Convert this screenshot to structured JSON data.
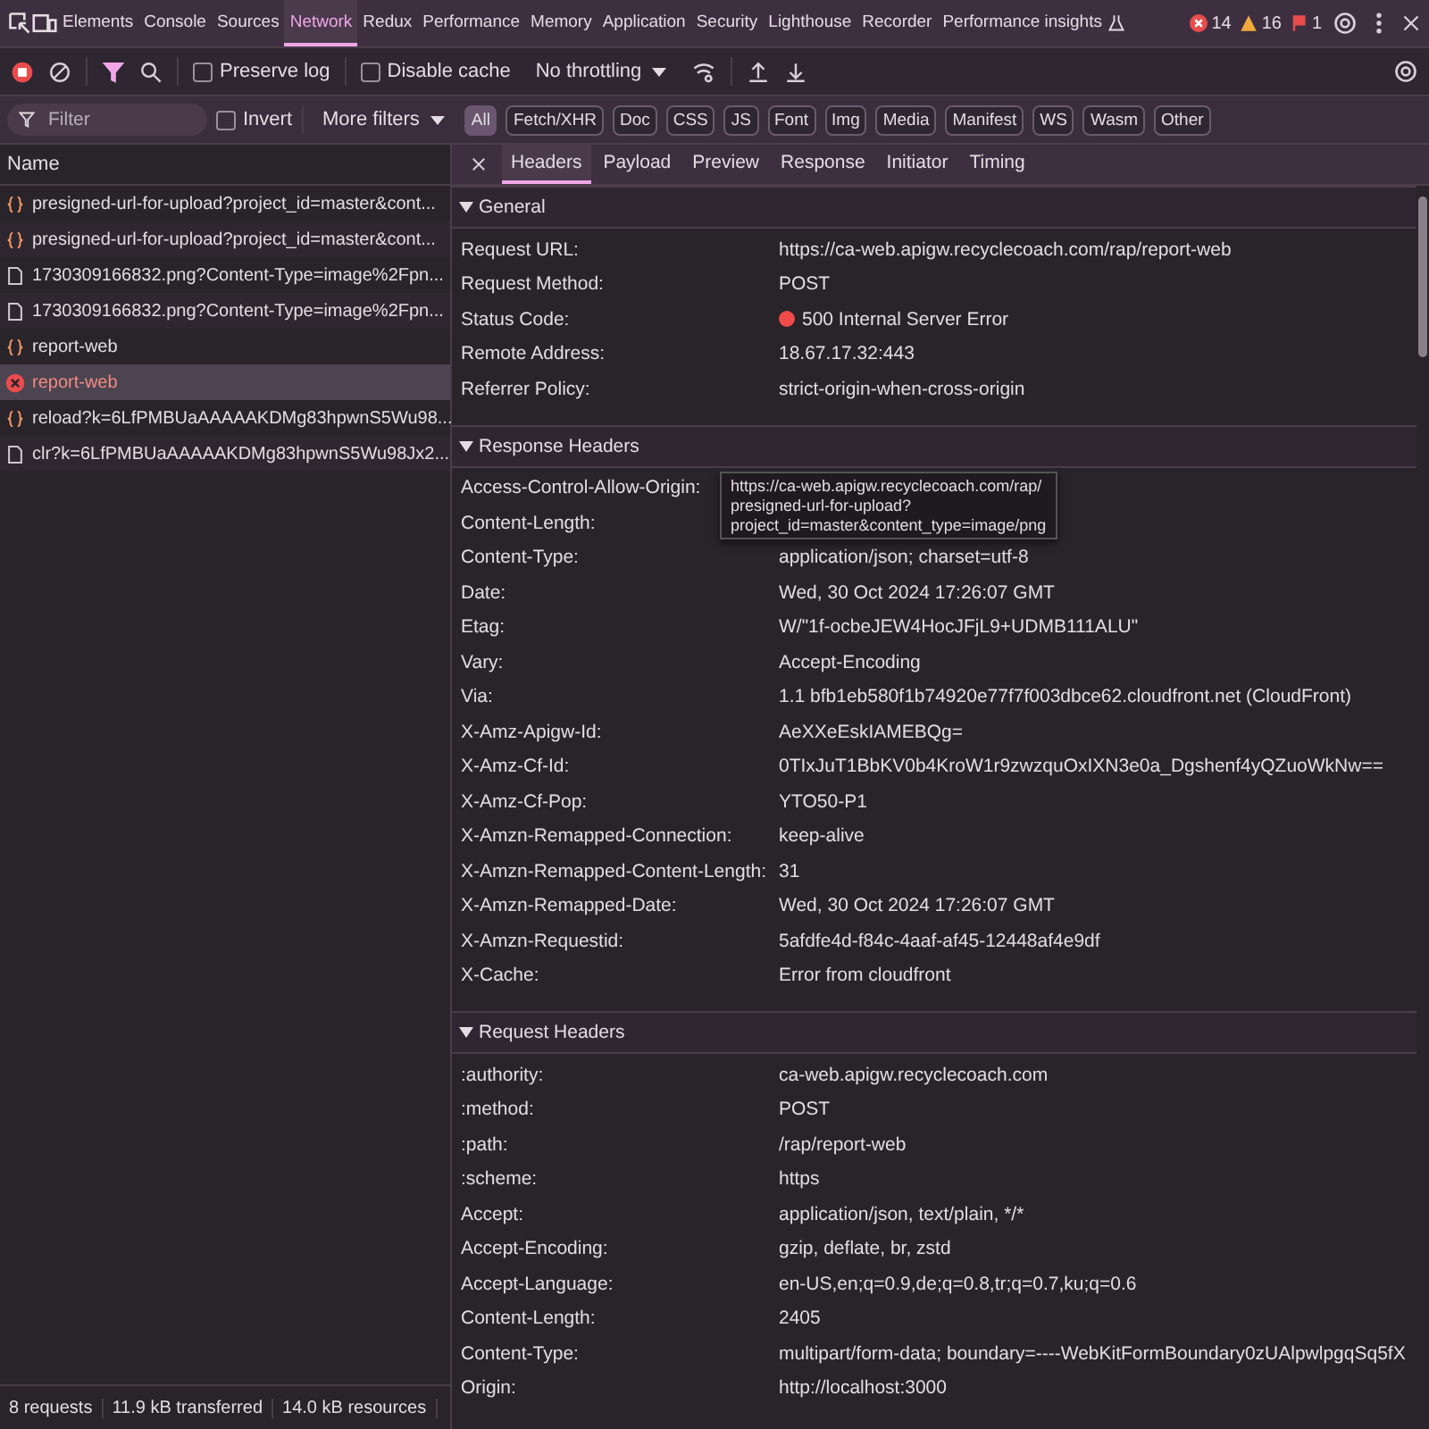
{
  "main_tabs": [
    {
      "label": "Elements",
      "selected": false
    },
    {
      "label": "Console",
      "selected": false
    },
    {
      "label": "Sources",
      "selected": false
    },
    {
      "label": "Network",
      "selected": true
    },
    {
      "label": "Redux",
      "selected": false
    },
    {
      "label": "Performance",
      "selected": false
    },
    {
      "label": "Memory",
      "selected": false
    },
    {
      "label": "Application",
      "selected": false
    },
    {
      "label": "Security",
      "selected": false
    },
    {
      "label": "Lighthouse",
      "selected": false
    },
    {
      "label": "Recorder",
      "selected": false
    },
    {
      "label": "Performance insights",
      "selected": false
    }
  ],
  "counters": {
    "errors": "14",
    "warnings": "16",
    "issues": "1"
  },
  "toolbar": {
    "recording": true,
    "filter_active": true,
    "preserve_log": {
      "label": "Preserve log",
      "checked": false
    },
    "disable_cache": {
      "label": "Disable cache",
      "checked": false
    },
    "throttling": "No throttling"
  },
  "filter_bar": {
    "placeholder": "Filter",
    "invert": {
      "label": "Invert",
      "checked": false
    },
    "more_filters": "More filters",
    "types": [
      {
        "label": "All",
        "selected": true
      },
      {
        "label": "Fetch/XHR",
        "selected": false
      },
      {
        "label": "Doc",
        "selected": false
      },
      {
        "label": "CSS",
        "selected": false
      },
      {
        "label": "JS",
        "selected": false
      },
      {
        "label": "Font",
        "selected": false
      },
      {
        "label": "Img",
        "selected": false
      },
      {
        "label": "Media",
        "selected": false
      },
      {
        "label": "Manifest",
        "selected": false
      },
      {
        "label": "WS",
        "selected": false
      },
      {
        "label": "Wasm",
        "selected": false
      },
      {
        "label": "Other",
        "selected": false
      }
    ]
  },
  "requests": {
    "column": "Name",
    "rows": [
      {
        "name": "presigned-url-for-upload?project_id=master&cont...",
        "kind": "fetch",
        "selected": false
      },
      {
        "name": "presigned-url-for-upload?project_id=master&cont...",
        "kind": "fetch",
        "selected": false
      },
      {
        "name": "1730309166832.png?Content-Type=image%2Fpn...",
        "kind": "document",
        "selected": false
      },
      {
        "name": "1730309166832.png?Content-Type=image%2Fpn...",
        "kind": "document",
        "selected": false
      },
      {
        "name": "report-web",
        "kind": "fetch",
        "selected": false
      },
      {
        "name": "report-web",
        "kind": "error",
        "selected": true
      },
      {
        "name": "reload?k=6LfPMBUaAAAAAKDMg83hpwnS5Wu98...",
        "kind": "fetch",
        "selected": false
      },
      {
        "name": "clr?k=6LfPMBUaAAAAAKDMg83hpwnS5Wu98Jx2...",
        "kind": "document",
        "selected": false
      }
    ]
  },
  "status_bar": [
    "8 requests",
    "11.9 kB transferred",
    "14.0 kB resources"
  ],
  "detail_tabs": [
    {
      "label": "Headers",
      "selected": true
    },
    {
      "label": "Payload",
      "selected": false
    },
    {
      "label": "Preview",
      "selected": false
    },
    {
      "label": "Response",
      "selected": false
    },
    {
      "label": "Initiator",
      "selected": false
    },
    {
      "label": "Timing",
      "selected": false
    }
  ],
  "sections": [
    {
      "title": "General",
      "expanded": true,
      "rows": [
        {
          "name": "Request URL:",
          "value": "https://ca-web.apigw.recyclecoach.com/rap/report-web"
        },
        {
          "name": "Request Method:",
          "value": "POST"
        },
        {
          "name": "Status Code:",
          "value": "500 Internal Server Error",
          "kind": "status"
        },
        {
          "name": "Remote Address:",
          "value": "18.67.17.32:443"
        },
        {
          "name": "Referrer Policy:",
          "value": "strict-origin-when-cross-origin"
        }
      ]
    },
    {
      "title": "Response Headers",
      "expanded": true,
      "rows": [
        {
          "name": "Access-Control-Allow-Origin:"
        },
        {
          "name": "Content-Length:"
        },
        {
          "name": "Content-Type:",
          "value": "application/json; charset=utf-8"
        },
        {
          "name": "Date:",
          "value": "Wed, 30 Oct 2024 17:26:07 GMT"
        },
        {
          "name": "Etag:",
          "value": "W/\"1f-ocbeJEW4HocJFjL9+UDMB111ALU\""
        },
        {
          "name": "Vary:",
          "value": "Accept-Encoding"
        },
        {
          "name": "Via:",
          "value": "1.1 bfb1eb580f1b74920e77f7f003dbce62.cloudfront.net (CloudFront)"
        },
        {
          "name": "X-Amz-Apigw-Id:",
          "value": "AeXXeEskIAMEBQg="
        },
        {
          "name": "X-Amz-Cf-Id:",
          "value": "0TIxJuT1BbKV0b4KroW1r9zwzquOxIXN3e0a_Dgshenf4yQZuoWkNw=="
        },
        {
          "name": "X-Amz-Cf-Pop:",
          "value": "YTO50-P1"
        },
        {
          "name": "X-Amzn-Remapped-Connection:",
          "value": "keep-alive"
        },
        {
          "name": "X-Amzn-Remapped-Content-Length:",
          "value": "31"
        },
        {
          "name": "X-Amzn-Remapped-Date:",
          "value": "Wed, 30 Oct 2024 17:26:07 GMT"
        },
        {
          "name": "X-Amzn-Requestid:",
          "value": "5afdfe4d-f84c-4aaf-af45-12448af4e9df"
        },
        {
          "name": "X-Cache:",
          "value": "Error from cloudfront"
        }
      ]
    },
    {
      "title": "Request Headers",
      "expanded": true,
      "rows": [
        {
          "name": ":authority:",
          "value": "ca-web.apigw.recyclecoach.com"
        },
        {
          "name": ":method:",
          "value": "POST"
        },
        {
          "name": ":path:",
          "value": "/rap/report-web"
        },
        {
          "name": ":scheme:",
          "value": "https"
        },
        {
          "name": "Accept:",
          "value": "application/json, text/plain, */*"
        },
        {
          "name": "Accept-Encoding:",
          "value": "gzip, deflate, br, zstd"
        },
        {
          "name": "Accept-Language:",
          "value": "en-US,en;q=0.9,de;q=0.8,tr;q=0.7,ku;q=0.6"
        },
        {
          "name": "Content-Length:",
          "value": "2405"
        },
        {
          "name": "Content-Type:",
          "value": "multipart/form-data; boundary=----WebKitFormBoundary0zUAlpwlpgqSq5fX"
        },
        {
          "name": "Origin:",
          "value": "http://localhost:3000"
        }
      ]
    }
  ],
  "tooltip": {
    "lines": [
      "https://ca-web.apigw.recyclecoach.com/rap/",
      "presigned-url-for-upload?",
      "project_id=master&content_type=image/png"
    ]
  }
}
